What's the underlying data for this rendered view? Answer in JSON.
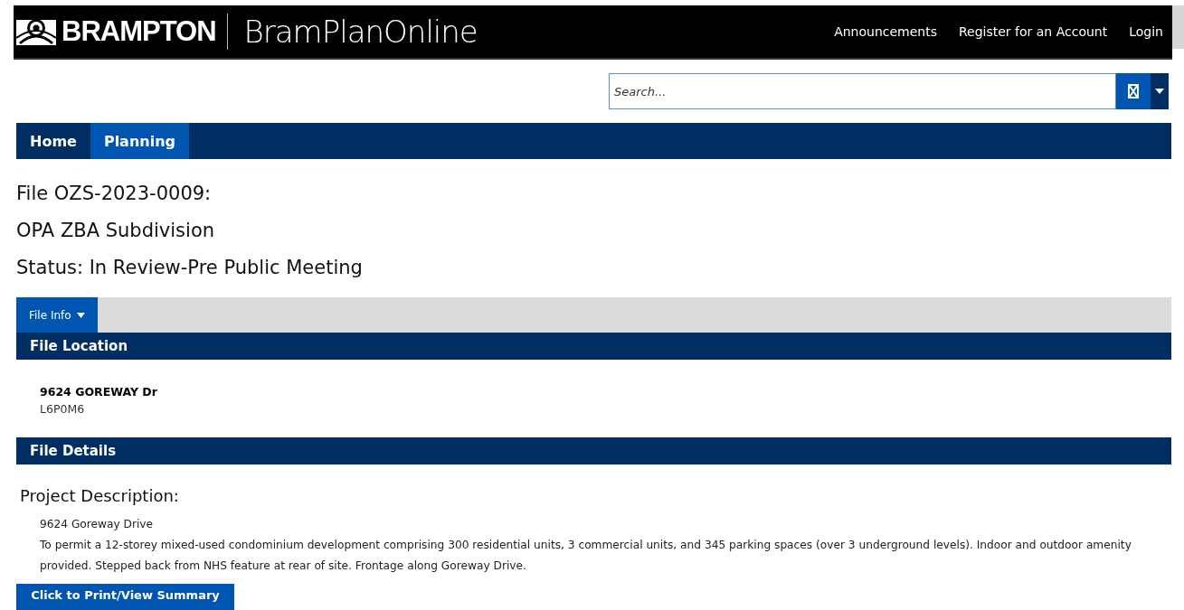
{
  "header": {
    "brand": "BRAMPTON",
    "product": "BramPlanOnline",
    "links": [
      {
        "label": "Announcements"
      },
      {
        "label": "Register for an Account"
      },
      {
        "label": "Login"
      }
    ]
  },
  "search": {
    "placeholder": "Search..."
  },
  "nav": [
    {
      "label": "Home",
      "selected": false
    },
    {
      "label": "Planning",
      "selected": true
    }
  ],
  "titles": [
    "File OZS-2023-0009:",
    "OPA ZBA Subdivision",
    "Status: In Review-Pre Public Meeting"
  ],
  "tabs": [
    {
      "label": "File Info",
      "selected": true
    }
  ],
  "sections": [
    {
      "kind": "location",
      "title": "File Location",
      "address": "9624 GOREWAY Dr",
      "postal": "L6P0M6"
    },
    {
      "kind": "details",
      "title": "File Details",
      "heading": "Project Description:",
      "lines": [
        "9624 Goreway Drive",
        "To permit a 12-storey mixed-used condominium development comprising 300 residential units, 3 commercial units, and 345 parking spaces (over 3 underground levels). Indoor and outdoor amenity provided. Stepped back from NHS feature at rear of site. Frontage along Goreway Drive."
      ]
    }
  ],
  "summary_button": "Click to Print/View Summary"
}
